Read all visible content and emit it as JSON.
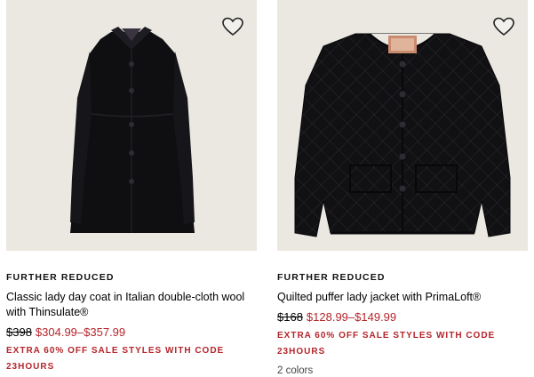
{
  "products": [
    {
      "flag": "FURTHER REDUCED",
      "name": "Classic lady day coat in Italian double-cloth wool with Thinsulate®",
      "was_price": "$398",
      "sale_price": "$304.99–$357.99",
      "promo": "EXTRA 60% OFF SALE STYLES WITH CODE 23HOURS",
      "image_icon": "black-wool-coat",
      "wishlist_icon": "heart-outline-icon"
    },
    {
      "flag": "FURTHER REDUCED",
      "name": "Quilted puffer lady jacket with PrimaLoft®",
      "was_price": "$168",
      "sale_price": "$128.99–$149.99",
      "promo": "EXTRA 60% OFF SALE STYLES WITH CODE 23HOURS",
      "colors": "2 colors",
      "image_icon": "black-quilted-jacket",
      "wishlist_icon": "heart-outline-icon"
    }
  ],
  "colors_palette": {
    "sale_red": "#b5252b",
    "image_bg": "#ebe8e2",
    "garment": "#111114"
  }
}
